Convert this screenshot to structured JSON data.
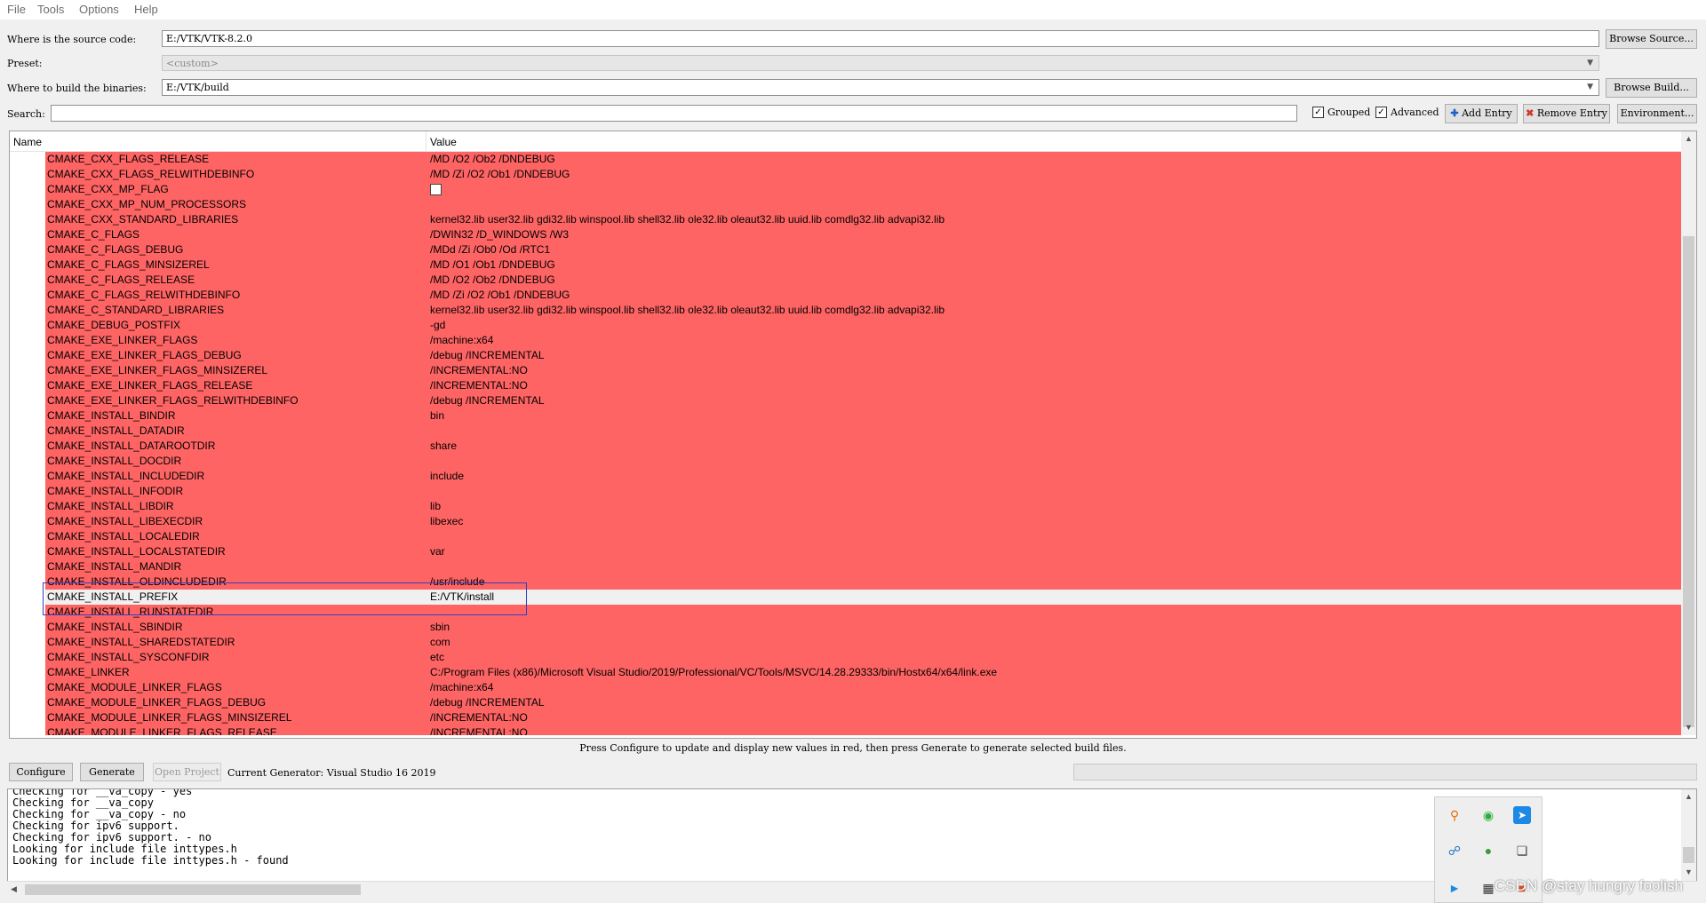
{
  "menu": [
    "File",
    "Tools",
    "Options",
    "Help"
  ],
  "source": {
    "label": "Where is the source code:",
    "value": "E:/VTK/VTK-8.2.0",
    "browse": "Browse Source..."
  },
  "preset": {
    "label": "Preset:",
    "value": "<custom>"
  },
  "build": {
    "label": "Where to build the binaries:",
    "value": "E:/VTK/build",
    "browse": "Browse Build..."
  },
  "search": {
    "label": "Search:",
    "value": ""
  },
  "options": {
    "grouped": "Grouped",
    "advanced": "Advanced",
    "grouped_checked": true,
    "advanced_checked": true
  },
  "toolbar": {
    "add_entry": "Add Entry",
    "remove_entry": "Remove Entry",
    "environment": "Environment..."
  },
  "table": {
    "headers": {
      "name": "Name",
      "value": "Value"
    },
    "rows": [
      {
        "name": "CMAKE_CXX_FLAGS_RELEASE",
        "value": "/MD /O2 /Ob2 /DNDEBUG"
      },
      {
        "name": "CMAKE_CXX_FLAGS_RELWITHDEBINFO",
        "value": "/MD /Zi /O2 /Ob1 /DNDEBUG"
      },
      {
        "name": "CMAKE_CXX_MP_FLAG",
        "value": "",
        "checkbox": true
      },
      {
        "name": "CMAKE_CXX_MP_NUM_PROCESSORS",
        "value": ""
      },
      {
        "name": "CMAKE_CXX_STANDARD_LIBRARIES",
        "value": "kernel32.lib user32.lib gdi32.lib winspool.lib shell32.lib ole32.lib oleaut32.lib uuid.lib comdlg32.lib advapi32.lib"
      },
      {
        "name": "CMAKE_C_FLAGS",
        "value": "/DWIN32 /D_WINDOWS /W3"
      },
      {
        "name": "CMAKE_C_FLAGS_DEBUG",
        "value": "/MDd /Zi /Ob0 /Od /RTC1"
      },
      {
        "name": "CMAKE_C_FLAGS_MINSIZEREL",
        "value": "/MD /O1 /Ob1 /DNDEBUG"
      },
      {
        "name": "CMAKE_C_FLAGS_RELEASE",
        "value": "/MD /O2 /Ob2 /DNDEBUG"
      },
      {
        "name": "CMAKE_C_FLAGS_RELWITHDEBINFO",
        "value": "/MD /Zi /O2 /Ob1 /DNDEBUG"
      },
      {
        "name": "CMAKE_C_STANDARD_LIBRARIES",
        "value": "kernel32.lib user32.lib gdi32.lib winspool.lib shell32.lib ole32.lib oleaut32.lib uuid.lib comdlg32.lib advapi32.lib"
      },
      {
        "name": "CMAKE_DEBUG_POSTFIX",
        "value": "-gd"
      },
      {
        "name": "CMAKE_EXE_LINKER_FLAGS",
        "value": "/machine:x64"
      },
      {
        "name": "CMAKE_EXE_LINKER_FLAGS_DEBUG",
        "value": "/debug /INCREMENTAL"
      },
      {
        "name": "CMAKE_EXE_LINKER_FLAGS_MINSIZEREL",
        "value": "/INCREMENTAL:NO"
      },
      {
        "name": "CMAKE_EXE_LINKER_FLAGS_RELEASE",
        "value": "/INCREMENTAL:NO"
      },
      {
        "name": "CMAKE_EXE_LINKER_FLAGS_RELWITHDEBINFO",
        "value": "/debug /INCREMENTAL"
      },
      {
        "name": "CMAKE_INSTALL_BINDIR",
        "value": "bin"
      },
      {
        "name": "CMAKE_INSTALL_DATADIR",
        "value": ""
      },
      {
        "name": "CMAKE_INSTALL_DATAROOTDIR",
        "value": "share"
      },
      {
        "name": "CMAKE_INSTALL_DOCDIR",
        "value": ""
      },
      {
        "name": "CMAKE_INSTALL_INCLUDEDIR",
        "value": "include"
      },
      {
        "name": "CMAKE_INSTALL_INFODIR",
        "value": ""
      },
      {
        "name": "CMAKE_INSTALL_LIBDIR",
        "value": "lib"
      },
      {
        "name": "CMAKE_INSTALL_LIBEXECDIR",
        "value": "libexec"
      },
      {
        "name": "CMAKE_INSTALL_LOCALEDIR",
        "value": ""
      },
      {
        "name": "CMAKE_INSTALL_LOCALSTATEDIR",
        "value": "var"
      },
      {
        "name": "CMAKE_INSTALL_MANDIR",
        "value": ""
      },
      {
        "name": "CMAKE_INSTALL_OLDINCLUDEDIR",
        "value": "/usr/include"
      },
      {
        "name": "CMAKE_INSTALL_PREFIX",
        "value": "E:/VTK/install",
        "selected": true
      },
      {
        "name": "CMAKE_INSTALL_RUNSTATEDIR",
        "value": ""
      },
      {
        "name": "CMAKE_INSTALL_SBINDIR",
        "value": "sbin"
      },
      {
        "name": "CMAKE_INSTALL_SHAREDSTATEDIR",
        "value": "com"
      },
      {
        "name": "CMAKE_INSTALL_SYSCONFDIR",
        "value": "etc"
      },
      {
        "name": "CMAKE_LINKER",
        "value": "C:/Program Files (x86)/Microsoft Visual Studio/2019/Professional/VC/Tools/MSVC/14.28.29333/bin/Hostx64/x64/link.exe"
      },
      {
        "name": "CMAKE_MODULE_LINKER_FLAGS",
        "value": "/machine:x64"
      },
      {
        "name": "CMAKE_MODULE_LINKER_FLAGS_DEBUG",
        "value": "/debug /INCREMENTAL"
      },
      {
        "name": "CMAKE_MODULE_LINKER_FLAGS_MINSIZEREL",
        "value": "/INCREMENTAL:NO"
      },
      {
        "name": "CMAKE_MODULE_LINKER_FLAGS_RELEASE",
        "value": "/INCREMENTAL:NO"
      }
    ]
  },
  "status_text": "Press Configure to update and display new values in red, then press Generate to generate selected build files.",
  "actions": {
    "configure": "Configure",
    "generate": "Generate",
    "open_project": "Open Project",
    "generator": "Current Generator: Visual Studio 16 2019"
  },
  "output_lines": [
    "Checking for __va_copy - yes",
    "Checking for __va_copy",
    "Checking for __va_copy - no",
    "Checking for ipv6 support.",
    "Checking for ipv6 support. - no",
    "Looking for include file inttypes.h",
    "Looking for include file inttypes.h - found"
  ],
  "watermark": "CSDN @stay hungry foolish",
  "colors": {
    "changed_row": "#ff6464",
    "highlight_box": "#2f3fc7"
  }
}
